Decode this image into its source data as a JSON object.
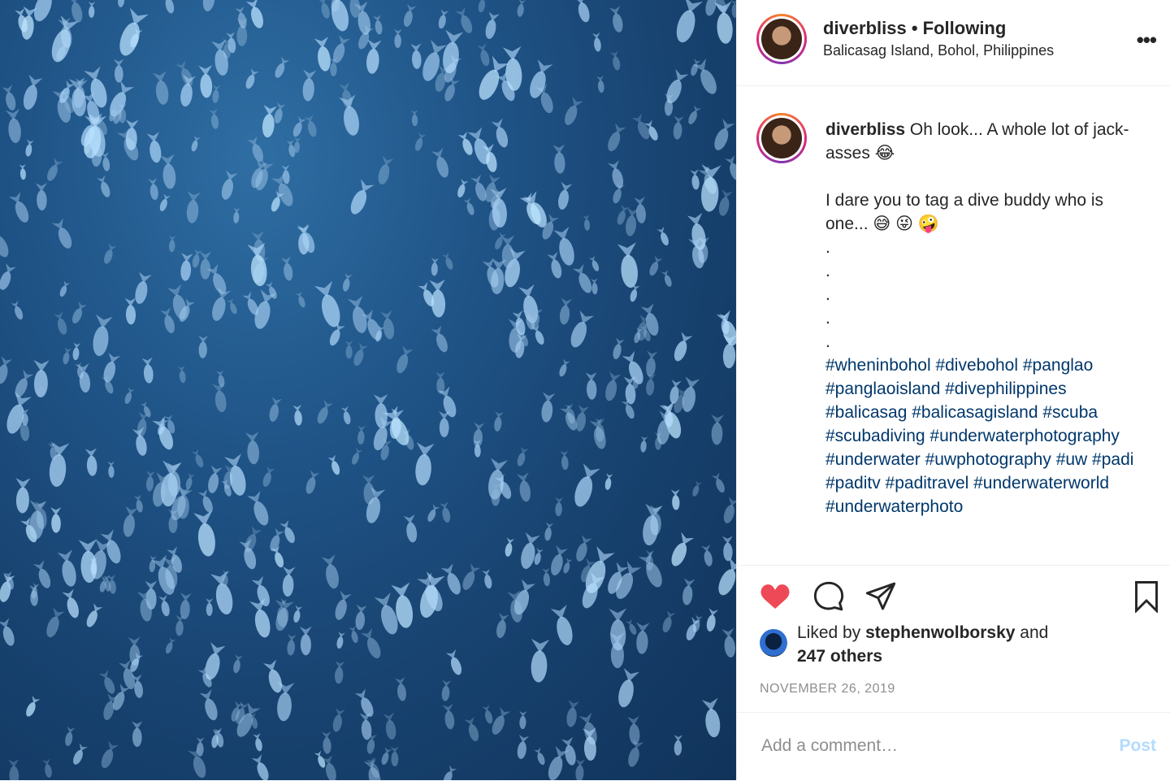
{
  "post": {
    "image_alt": "School of jack fish underwater",
    "image_colors": {
      "deep": "#10335a",
      "mid": "#1f5386",
      "light": "#2f6ea3"
    }
  },
  "header": {
    "username": "diverbliss",
    "separator": "•",
    "follow_status": "Following",
    "location": "Balicasag Island, Bohol, Philippines",
    "more_icon": "more-horizontal-icon"
  },
  "caption": {
    "username": "diverbliss",
    "line1": "Oh look... A whole lot of jack-asses 😂",
    "line2": "I dare you to tag a dive buddy who is one... 😅 😜 🤪",
    "dots": [
      ".",
      ".",
      ".",
      ".",
      "."
    ],
    "hashtags": "#wheninbohol #divebohol #panglao #panglaoisland #divephilippines #balicasag #balicasagisland #scuba #scubadiving #underwaterphotography #underwater #uwphotography #uw #padi #paditv #paditravel #underwaterworld #underwaterphoto"
  },
  "actions": {
    "like_icon": "heart-icon",
    "like_color": "#ed4956",
    "comment_icon": "comment-icon",
    "share_icon": "share-icon",
    "save_icon": "bookmark-icon"
  },
  "likes": {
    "prefix": "Liked by",
    "liker": "stephenwolborsky",
    "joiner": "and",
    "others": "247 others"
  },
  "date": "NOVEMBER 26, 2019",
  "comment": {
    "placeholder": "Add a comment…",
    "post_label": "Post"
  }
}
